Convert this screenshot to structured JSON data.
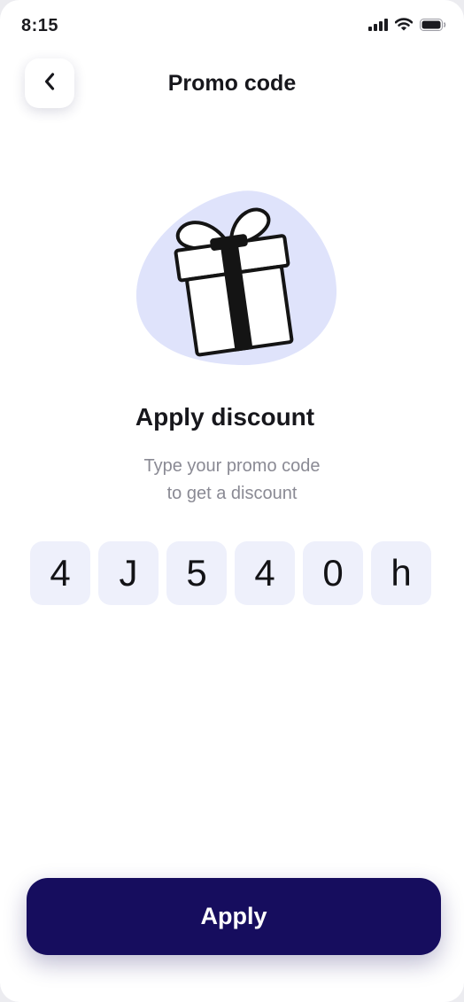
{
  "status_bar": {
    "time": "8:15",
    "icons": [
      "cellular-signal-icon",
      "wifi-icon",
      "battery-icon"
    ]
  },
  "header": {
    "back_icon": "chevron-left-icon",
    "title": "Promo code"
  },
  "illustration": {
    "icon": "gift-icon",
    "blob_color": "#dfe3fb"
  },
  "content": {
    "heading": "Apply discount",
    "subtitle_line1": "Type your promo code",
    "subtitle_line2": "to get a discount"
  },
  "promo_code": {
    "characters": [
      "4",
      "J",
      "5",
      "4",
      "0",
      "h"
    ]
  },
  "footer": {
    "apply_label": "Apply"
  },
  "colors": {
    "primary": "#160d5e",
    "code_cell_bg": "#eef0fb",
    "text": "#17171c",
    "muted_text": "#8a8a94"
  }
}
